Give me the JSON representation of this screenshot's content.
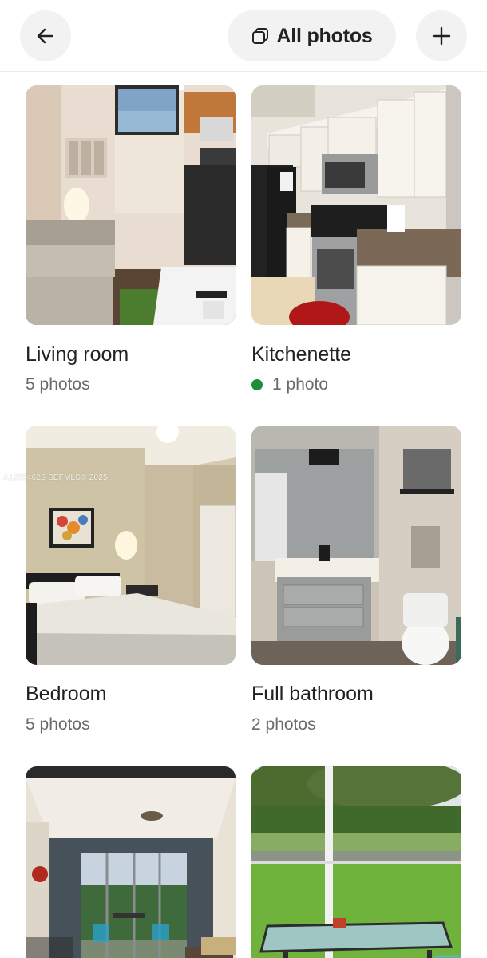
{
  "header": {
    "back_icon": "arrow-left-icon",
    "all_photos_label": "All photos",
    "all_photos_icon": "stacked-squares-icon",
    "add_icon": "plus-icon"
  },
  "rooms": [
    {
      "title": "Living room",
      "subtitle": "5 photos",
      "status_dot": false
    },
    {
      "title": "Kitchenette",
      "subtitle": "1 photo",
      "status_dot": true,
      "status_color": "#1e8e3e"
    },
    {
      "title": "Bedroom",
      "subtitle": "5 photos",
      "status_dot": false
    },
    {
      "title": "Full bathroom",
      "subtitle": "2 photos",
      "status_dot": false
    },
    {
      "title": "",
      "subtitle": "",
      "status_dot": false
    },
    {
      "title": "",
      "subtitle": "",
      "status_dot": false
    }
  ],
  "watermark": "A12054625 SEFMLS® 2025"
}
